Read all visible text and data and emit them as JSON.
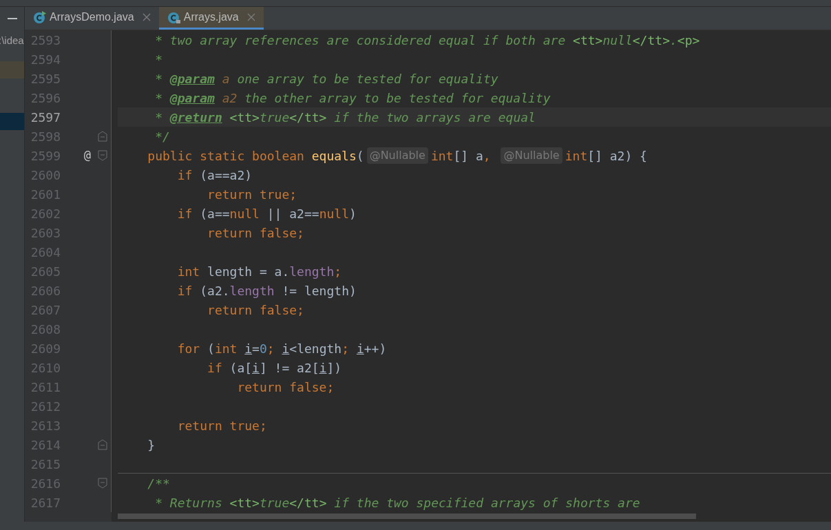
{
  "sidebar": {
    "path_fragment": ":\\idea",
    "rows": [
      {
        "kind": "highlight"
      },
      {
        "kind": "selected"
      }
    ]
  },
  "tabs": [
    {
      "label": "ArraysDemo.java",
      "kind": "runnable",
      "selected": false
    },
    {
      "label": "Arrays.java",
      "kind": "readonly",
      "selected": true
    }
  ],
  "editor": {
    "lines": [
      {
        "number": "2593",
        "tokens": [
          {
            "text": "     * two array references are considered equal if both are ",
            "kind": "comment"
          },
          {
            "text": "<tt>",
            "kind": "markup"
          },
          {
            "text": "null",
            "kind": "comment"
          },
          {
            "text": "</tt>",
            "kind": "markup"
          },
          {
            "text": ".",
            "kind": "comment"
          },
          {
            "text": "<p>",
            "kind": "markup"
          }
        ]
      },
      {
        "number": "2594",
        "tokens": [
          {
            "text": "     *",
            "kind": "comment"
          }
        ]
      },
      {
        "number": "2595",
        "tokens": [
          {
            "text": "     * ",
            "kind": "comment"
          },
          {
            "text": "@param",
            "kind": "doctag"
          },
          {
            "text": " a",
            "kind": "docparam"
          },
          {
            "text": " one array to be tested for equality",
            "kind": "comment"
          }
        ]
      },
      {
        "number": "2596",
        "tokens": [
          {
            "text": "     * ",
            "kind": "comment"
          },
          {
            "text": "@param",
            "kind": "doctag"
          },
          {
            "text": " a2",
            "kind": "docparam"
          },
          {
            "text": " the other array to be tested for equality",
            "kind": "comment"
          }
        ]
      },
      {
        "number": "2597",
        "current": true,
        "tokens": [
          {
            "text": "     * ",
            "kind": "comment"
          },
          {
            "text": "@return",
            "kind": "doctag"
          },
          {
            "text": " <tt>",
            "kind": "markup"
          },
          {
            "text": "true",
            "kind": "comment"
          },
          {
            "text": "</tt>",
            "kind": "markup"
          },
          {
            "text": " if the two arrays are equal",
            "kind": "comment"
          }
        ]
      },
      {
        "number": "2598",
        "fold_end": true,
        "tokens": [
          {
            "text": "     */",
            "kind": "comment"
          }
        ]
      },
      {
        "number": "2599",
        "fold_start": true,
        "gutter_mark": "@",
        "tokens": [
          {
            "text": "    public static boolean ",
            "kind": "keyword"
          },
          {
            "text": "equals",
            "kind": "method"
          },
          {
            "text": "(",
            "kind": "plain"
          },
          {
            "text": "@Nullable",
            "kind": "hint"
          },
          {
            "text": "int",
            "kind": "keyword"
          },
          {
            "text": "[] a",
            "kind": "plain"
          },
          {
            "text": ", ",
            "kind": "keyword"
          },
          {
            "text": "@Nullable",
            "kind": "hint"
          },
          {
            "text": "int",
            "kind": "keyword"
          },
          {
            "text": "[] a2) {",
            "kind": "plain"
          }
        ]
      },
      {
        "number": "2600",
        "tokens": [
          {
            "text": "        if",
            "kind": "keyword"
          },
          {
            "text": " (a==a2)",
            "kind": "plain"
          }
        ]
      },
      {
        "number": "2601",
        "tokens": [
          {
            "text": "            return true;",
            "kind": "keyword"
          }
        ]
      },
      {
        "number": "2602",
        "tokens": [
          {
            "text": "        if",
            "kind": "keyword"
          },
          {
            "text": " (a==",
            "kind": "plain"
          },
          {
            "text": "null",
            "kind": "keyword"
          },
          {
            "text": " || a2==",
            "kind": "plain"
          },
          {
            "text": "null",
            "kind": "keyword"
          },
          {
            "text": ")",
            "kind": "plain"
          }
        ]
      },
      {
        "number": "2603",
        "tokens": [
          {
            "text": "            return false;",
            "kind": "keyword"
          }
        ]
      },
      {
        "number": "2604"
      },
      {
        "number": "2605",
        "tokens": [
          {
            "text": "        int",
            "kind": "keyword"
          },
          {
            "text": " length = a.",
            "kind": "plain"
          },
          {
            "text": "length",
            "kind": "field"
          },
          {
            "text": ";",
            "kind": "keyword"
          }
        ]
      },
      {
        "number": "2606",
        "tokens": [
          {
            "text": "        if",
            "kind": "keyword"
          },
          {
            "text": " (a2.",
            "kind": "plain"
          },
          {
            "text": "length",
            "kind": "field"
          },
          {
            "text": " != length)",
            "kind": "plain"
          }
        ]
      },
      {
        "number": "2607",
        "tokens": [
          {
            "text": "            return false;",
            "kind": "keyword"
          }
        ]
      },
      {
        "number": "2608"
      },
      {
        "number": "2609",
        "tokens": [
          {
            "text": "        for",
            "kind": "keyword"
          },
          {
            "text": " (",
            "kind": "plain"
          },
          {
            "text": "int ",
            "kind": "keyword"
          },
          {
            "text": "i",
            "kind": "reassigned"
          },
          {
            "text": "=",
            "kind": "plain"
          },
          {
            "text": "0",
            "kind": "number"
          },
          {
            "text": "; ",
            "kind": "keyword"
          },
          {
            "text": "i",
            "kind": "reassigned"
          },
          {
            "text": "<length",
            "kind": "plain"
          },
          {
            "text": "; ",
            "kind": "keyword"
          },
          {
            "text": "i",
            "kind": "reassigned"
          },
          {
            "text": "++)",
            "kind": "plain"
          }
        ]
      },
      {
        "number": "2610",
        "tokens": [
          {
            "text": "            if",
            "kind": "keyword"
          },
          {
            "text": " (a[",
            "kind": "plain"
          },
          {
            "text": "i",
            "kind": "reassigned"
          },
          {
            "text": "] != a2[",
            "kind": "plain"
          },
          {
            "text": "i",
            "kind": "reassigned"
          },
          {
            "text": "])",
            "kind": "plain"
          }
        ]
      },
      {
        "number": "2611",
        "tokens": [
          {
            "text": "                return false;",
            "kind": "keyword"
          }
        ]
      },
      {
        "number": "2612"
      },
      {
        "number": "2613",
        "tokens": [
          {
            "text": "        return true;",
            "kind": "keyword"
          }
        ]
      },
      {
        "number": "2614",
        "fold_end": true,
        "tokens": [
          {
            "text": "    }",
            "kind": "plain"
          }
        ]
      },
      {
        "number": "2615",
        "separator_after": true
      },
      {
        "number": "2616",
        "fold_start": true,
        "tokens": [
          {
            "text": "    /**",
            "kind": "comment"
          }
        ]
      },
      {
        "number": "2617",
        "tokens": [
          {
            "text": "     * Returns ",
            "kind": "comment"
          },
          {
            "text": "<tt>",
            "kind": "markup"
          },
          {
            "text": "true",
            "kind": "comment"
          },
          {
            "text": "</tt>",
            "kind": "markup"
          },
          {
            "text": " if the two specified arrays of shorts are",
            "kind": "comment"
          }
        ]
      }
    ]
  }
}
